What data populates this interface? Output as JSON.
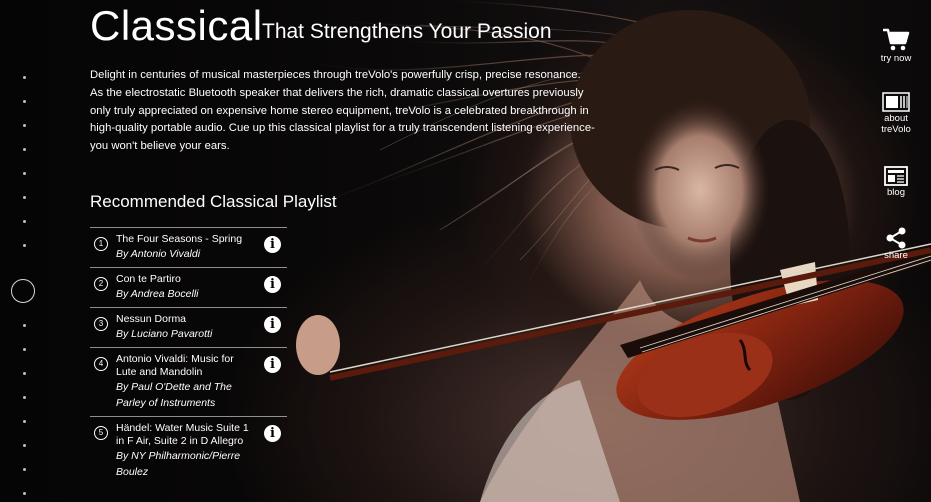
{
  "hero": {
    "title": "Classical",
    "subtitle": "That Strengthens Your Passion",
    "description": "Delight in centuries of musical masterpieces through treVolo's powerfully crisp, precise resonance. As the electrostatic Bluetooth speaker that delivers the rich, dramatic classical overtures previously only truly appreciated on expensive home stereo equipment, treVolo is a celebrated breakthrough in high-quality portable audio. Cue up this classical playlist for a truly transcendent listening experience- you won't believe your ears."
  },
  "playlist": {
    "heading": "Recommended Classical Playlist",
    "tracks": [
      {
        "num": "1",
        "title": "The Four Seasons - Spring",
        "artist": "By Antonio Vivaldi",
        "info_icon": "info-icon"
      },
      {
        "num": "2",
        "title": "Con te Partiro",
        "artist": "By Andrea Bocelli",
        "info_icon": "info-icon"
      },
      {
        "num": "3",
        "title": "Nessun Dorma",
        "artist": "By Luciano Pavarotti",
        "info_icon": "info-icon"
      },
      {
        "num": "4",
        "title": "Antonio Vivaldi: Music for Lute and Mandolin",
        "artist": "By Paul O'Dette and The Parley of Instruments",
        "info_icon": "info-icon"
      },
      {
        "num": "5",
        "title": "Händel: Water Music Suite 1 in F Air, Suite 2 in D Allegro",
        "artist": "By NY Philharmonic/Pierre Boulez",
        "info_icon": "info-icon"
      }
    ]
  },
  "side_nav": {
    "try_now": {
      "label": "try now",
      "icon": "cart-icon"
    },
    "about": {
      "label_line1": "about",
      "label_line2": "treVolo",
      "icon": "speaker-icon"
    },
    "blog": {
      "label": "blog",
      "icon": "blog-icon"
    },
    "share": {
      "label": "share",
      "icon": "share-icon"
    }
  },
  "section_nav": {
    "dot_count": 18,
    "active_index": 8
  },
  "colors": {
    "background": "#000000",
    "text": "#ffffff",
    "violin": "#8a2a14"
  }
}
